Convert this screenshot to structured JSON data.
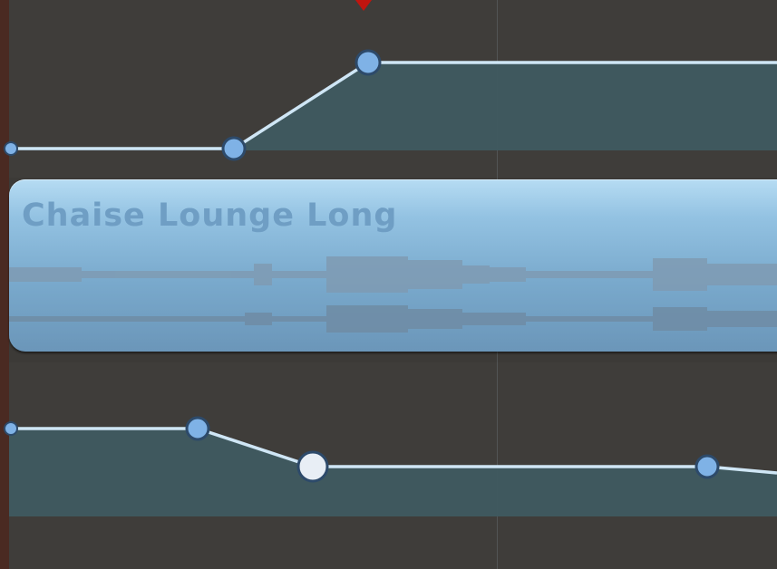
{
  "region": {
    "title": "Chaise Lounge Long"
  },
  "colors": {
    "background": "#3c3a37",
    "automation_fill": "#3f5a60",
    "automation_line": "#cfe6f5",
    "node": "#7fb2e6",
    "node_active": "#e8eef5",
    "region_top": "#b6dcf3",
    "region_bottom": "#6b96b9",
    "region_title": "#6f9ec4",
    "playhead": "#c0150f"
  },
  "icons": {
    "playhead": "playhead-triangle-icon",
    "node": "automation-node-icon"
  }
}
